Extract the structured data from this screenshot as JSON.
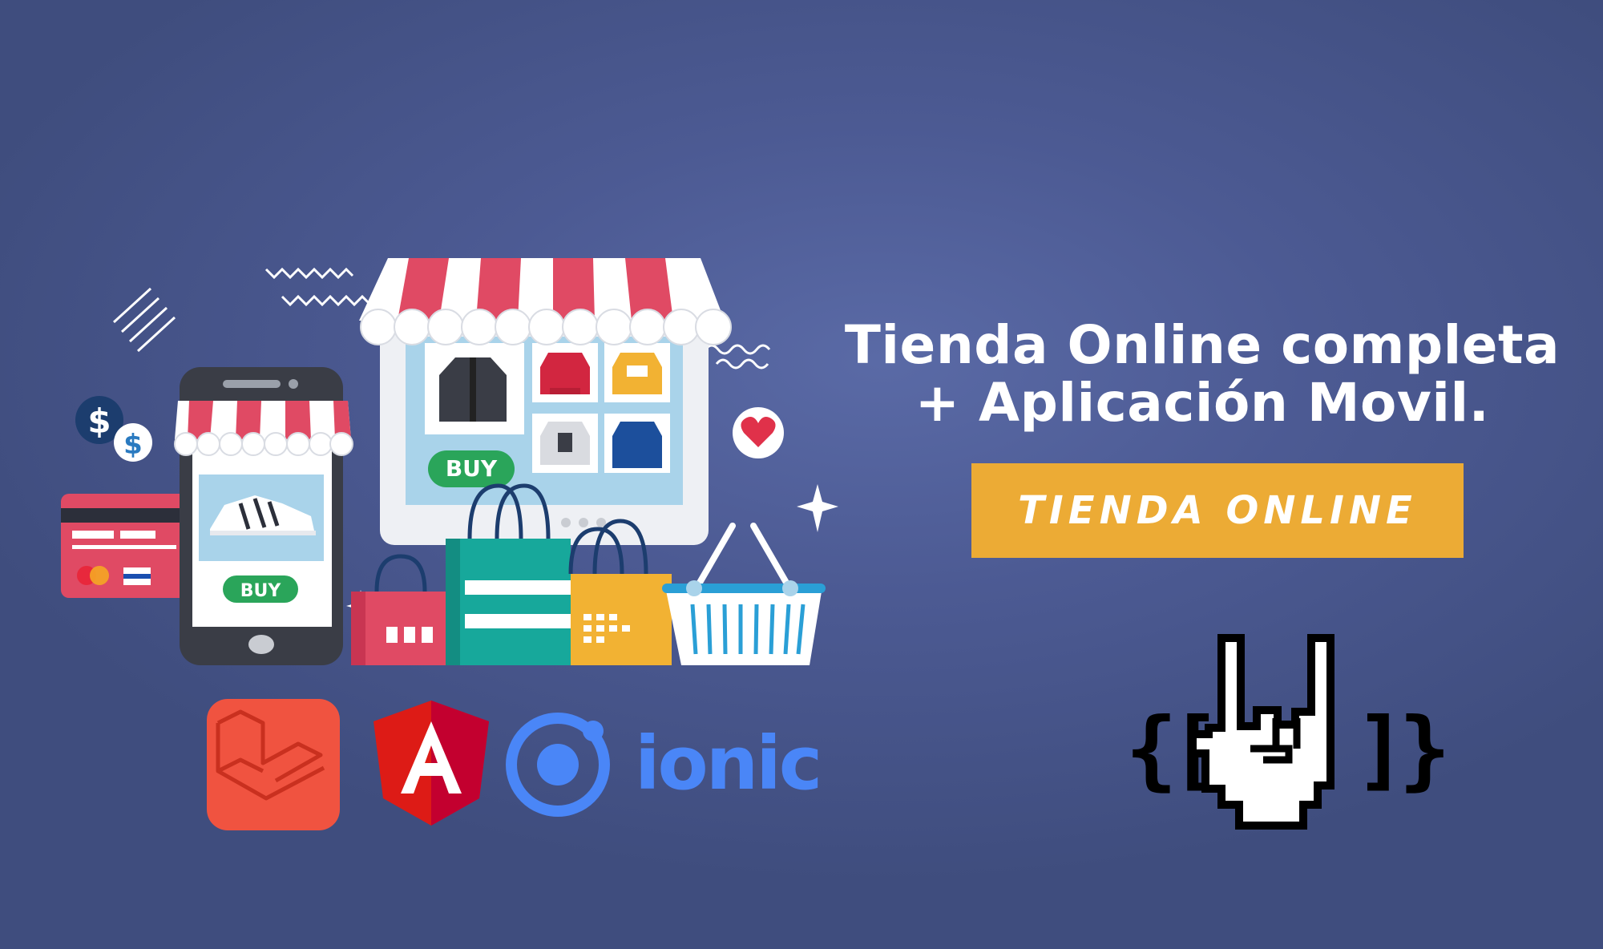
{
  "headline": {
    "line1": "Tienda Online completa",
    "line2": "+ Aplicación Movil."
  },
  "cta": {
    "label": "TIENDA ONLINE",
    "color": "#ecab35"
  },
  "store": {
    "buy_label": "BUY"
  },
  "phone": {
    "buy_label": "BUY"
  },
  "logos": {
    "ionic_text": "ionic"
  },
  "brand": {
    "left_braces": "{[",
    "right_braces": "]}"
  },
  "colors": {
    "background": "#4c5a93",
    "awning_red": "#e04a64",
    "buy_green": "#2aa55a",
    "laravel": "#f05340",
    "angular": "#dd1b16",
    "ionic": "#4a86f7"
  }
}
